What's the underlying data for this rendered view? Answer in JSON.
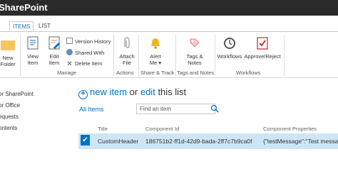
{
  "app": {
    "title": "SharePoint"
  },
  "tabs": [
    {
      "label": ""
    },
    {
      "label": "ITEMS"
    },
    {
      "label": "LIST"
    }
  ],
  "ribbon": {
    "new_folder": [
      "New",
      "Folder"
    ],
    "view_item": [
      "View",
      "Item"
    ],
    "edit_item": [
      "Edit",
      "Item"
    ],
    "version_history": "Version History",
    "shared_with": "Shared With",
    "delete_item": "Delete Item",
    "attach_file": [
      "Attach",
      "File"
    ],
    "alert_me": [
      "Alert",
      "Me"
    ],
    "tags_notes": [
      "Tags &",
      "Notes"
    ],
    "workflows": "Workflows",
    "approve_reject": "Approve/Reject",
    "groups": {
      "manage": "Manage",
      "actions": "Actions",
      "share_track": "Share & Track",
      "tags_notes": "Tags and Notes",
      "workflows": "Workflows"
    }
  },
  "nav": [
    "or SharePoint",
    "or Office",
    "equests",
    "ontents"
  ],
  "list": {
    "new_item": "new item",
    "or_text": "or",
    "edit": "edit",
    "this_list": "this list",
    "view": "All Items",
    "search_placeholder": "Find an item",
    "columns": [
      "Title",
      "Component Id",
      "Component Properties"
    ],
    "rows": [
      {
        "title": "CustomHeader",
        "component_id": "186751b2-ff1d-42d9-bada-2ff7c7b9ca0f",
        "properties": "{\"testMessage\":\"Test messa"
      }
    ]
  },
  "colors": {
    "accent": "#0072c6",
    "topbar": "#2b2b2b",
    "selected_row": "#cde6f7"
  }
}
